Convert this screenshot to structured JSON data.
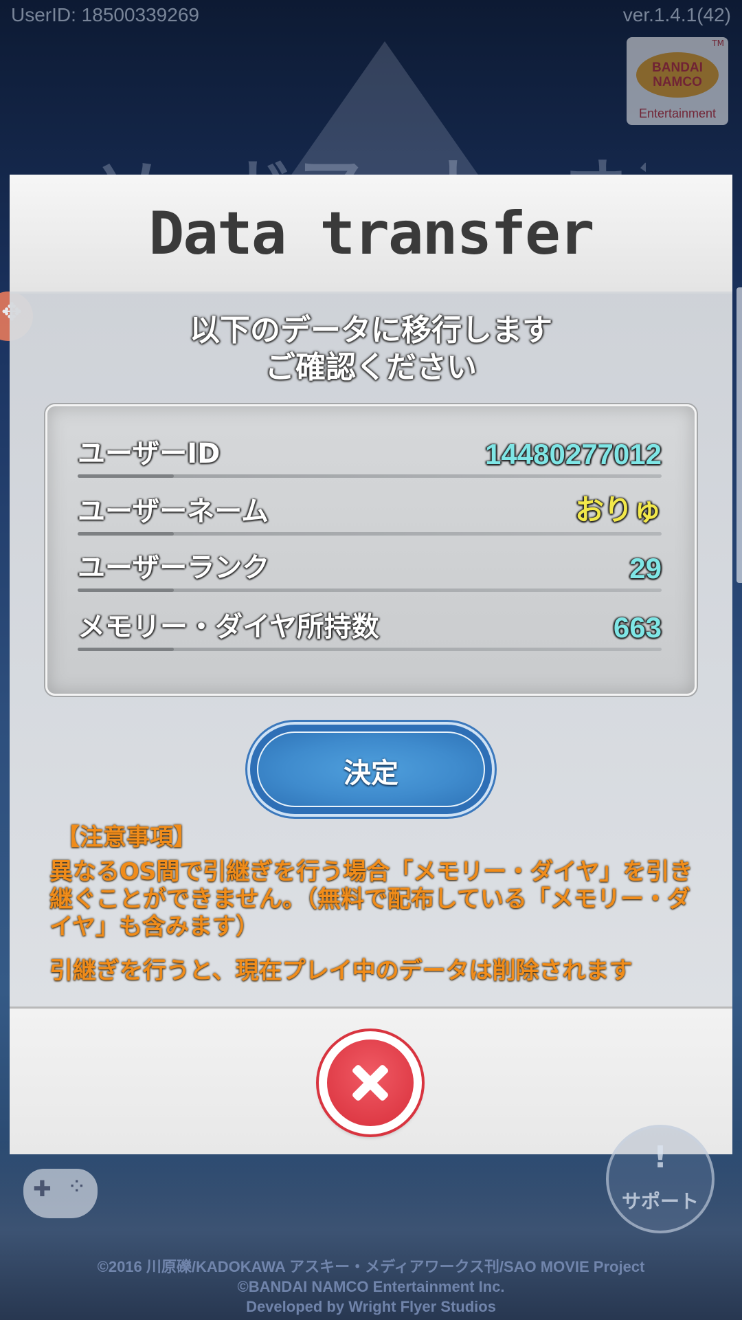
{
  "status": {
    "user_id": "UserID: 18500339269",
    "version": "ver.1.4.1(42)"
  },
  "logo": {
    "line1": "BANDAI",
    "line2": "NAMCO",
    "line3": "Entertainment",
    "tm": "TM"
  },
  "background": {
    "game_title": "ソードアート・オンライン"
  },
  "dialog": {
    "title": "Data transfer",
    "message_line1": "以下のデータに移行します",
    "message_line2": "ご確認ください",
    "rows": [
      {
        "label": "ユーザーID",
        "value": "14480277012",
        "color": "#7fe6e6"
      },
      {
        "label": "ユーザーネーム",
        "value": "おりゅ",
        "color": "#f2e84a"
      },
      {
        "label": "ユーザーランク",
        "value": "29",
        "color": "#7fe6e6"
      },
      {
        "label": "メモリー・ダイヤ所持数",
        "value": "663",
        "color": "#7fe6e6"
      }
    ],
    "confirm_label": "決定",
    "note_heading": "【注意事項】",
    "note_body": "異なるOS間で引継ぎを行う場合「メモリー・ダイヤ」を引き継ぐことができません。（無料で配布している「メモリー・ダイヤ」も含みます）",
    "note_warning": "引継ぎを行うと、現在プレイ中のデータは削除されます",
    "close_icon": "close-icon"
  },
  "bottom": {
    "support_label": "サポート"
  },
  "copyright": {
    "line1": "©2016 川原礫/KADOKAWA アスキー・メディアワークス刊/SAO MOVIE Project",
    "line2": "©BANDAI NAMCO Entertainment Inc.",
    "line3": "Developed by Wright Flyer Studios"
  },
  "colors": {
    "accent_blue": "#3f8bcd",
    "close_red": "#d82f3b",
    "note_orange": "#f08c1a"
  }
}
